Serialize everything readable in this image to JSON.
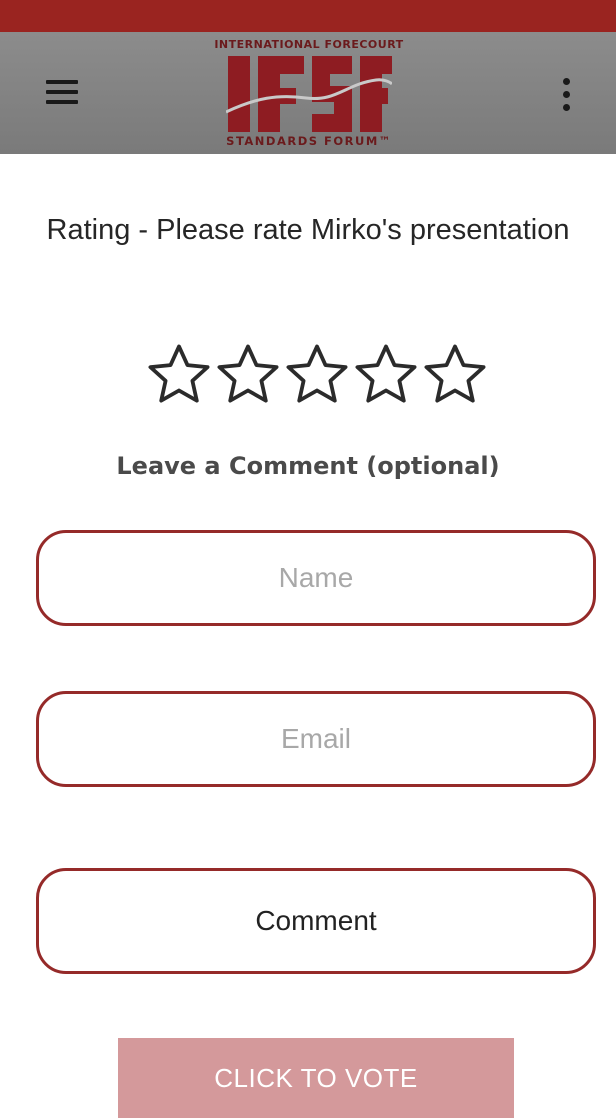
{
  "logo": {
    "top_text": "INTERNATIONAL FORECOURT",
    "wordmark": "IFSF",
    "bottom_text": "STANDARDS FORUM™",
    "brand_color": "#8e1c22"
  },
  "header": {
    "menu_icon": "hamburger-menu-icon",
    "more_icon": "vertical-dots-icon",
    "background_color": "#828282",
    "status_bar_color": "#9a2420"
  },
  "rating": {
    "title": "Rating - Please rate Mirko's presentation",
    "star_count": 5,
    "selected": 0
  },
  "comment_section": {
    "heading": "Leave a Comment (optional)"
  },
  "form": {
    "name_placeholder": "Name",
    "email_placeholder": "Email",
    "comment_placeholder": "Comment",
    "border_color": "#952a29"
  },
  "vote_button": {
    "label": "CLICK TO VOTE",
    "color": "#d4999b"
  }
}
